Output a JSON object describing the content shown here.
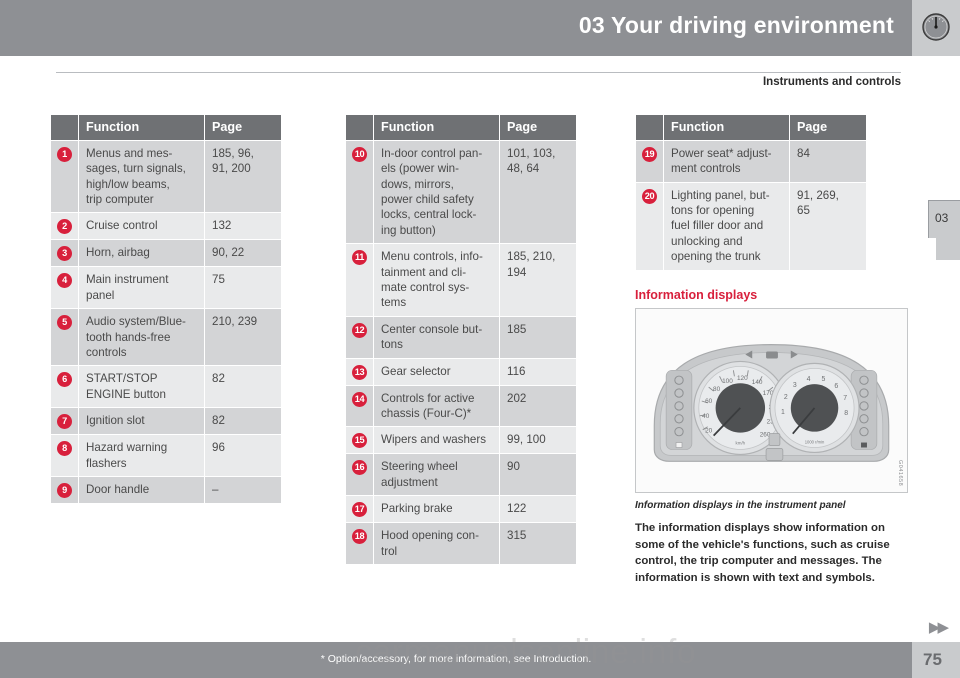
{
  "header": {
    "title": "03 Your driving environment",
    "gauge_icon": "gauge-icon",
    "subtitle": "Instruments and controls"
  },
  "chapter_tab": {
    "label": "03"
  },
  "tables": [
    {
      "id": "table-1",
      "headers": {
        "number": "",
        "function": "Function",
        "page": "Page"
      },
      "rows": [
        {
          "number": "1",
          "function": "Menus and mes-\nsages, turn signals,\nhigh/low beams,\ntrip computer",
          "page": "185, 96,\n91, 200"
        },
        {
          "number": "2",
          "function": "Cruise control",
          "page": "132"
        },
        {
          "number": "3",
          "function": "Horn, airbag",
          "page": "90, 22"
        },
        {
          "number": "4",
          "function": "Main instrument\npanel",
          "page": "75"
        },
        {
          "number": "5",
          "function": "Audio system/Blue-\ntooth hands-free\ncontrols",
          "page": "210, 239"
        },
        {
          "number": "6",
          "function": "START/STOP\nENGINE button",
          "page": "82"
        },
        {
          "number": "7",
          "function": "Ignition slot",
          "page": "82"
        },
        {
          "number": "8",
          "function": "Hazard warning\nflashers",
          "page": "96"
        },
        {
          "number": "9",
          "function": "Door handle",
          "page": "–"
        }
      ]
    },
    {
      "id": "table-2",
      "headers": {
        "number": "",
        "function": "Function",
        "page": "Page"
      },
      "rows": [
        {
          "number": "10",
          "function": "In-door control pan-\nels (power win-\ndows, mirrors,\npower child safety\nlocks, central lock-\ning button)",
          "page": "101, 103,\n48, 64"
        },
        {
          "number": "11",
          "function": "Menu controls, info-\ntainment and cli-\nmate control sys-\ntems",
          "page": "185, 210,\n194"
        },
        {
          "number": "12",
          "function": "Center console but-\ntons",
          "page": "185"
        },
        {
          "number": "13",
          "function": "Gear selector",
          "page": "116"
        },
        {
          "number": "14",
          "function": "Controls for active\nchassis (Four-C)*",
          "page": "202"
        },
        {
          "number": "15",
          "function": "Wipers and washers",
          "page": "99, 100"
        },
        {
          "number": "16",
          "function": "Steering wheel\nadjustment",
          "page": "90"
        },
        {
          "number": "17",
          "function": "Parking brake",
          "page": "122"
        },
        {
          "number": "18",
          "function": "Hood opening con-\ntrol",
          "page": "315"
        }
      ]
    },
    {
      "id": "table-3",
      "headers": {
        "number": "",
        "function": "Function",
        "page": "Page"
      },
      "rows": [
        {
          "number": "19",
          "function": "Power seat* adjust-\nment controls",
          "page": "84"
        },
        {
          "number": "20",
          "function": "Lighting panel, but-\ntons for opening\nfuel filler door and\nunlocking and\nopening the trunk",
          "page": "91, 269,\n65"
        }
      ]
    }
  ],
  "info_section": {
    "heading": "Information displays",
    "figure_code": "G041658",
    "figure_caption": "Information displays in the instrument panel",
    "body": "The information displays show information on some of the vehicle's functions, such as cruise control, the trip computer and messages. The information is shown with text and symbols.",
    "speedometer_ticks": [
      "20",
      "40",
      "60",
      "80",
      "100",
      "120",
      "140",
      "170",
      "200",
      "230",
      "260"
    ],
    "speedometer_unit": "km/h",
    "tachometer_ticks": [
      "1",
      "2",
      "3",
      "4",
      "5",
      "6",
      "7",
      "8"
    ],
    "tachometer_unit": "1000 r/min"
  },
  "footer": {
    "footnote": "* Option/accessory, for more information, see Introduction.",
    "page_number": "75",
    "forward_marker": "▶▶"
  },
  "watermark": "carmanualsonline.info",
  "colors": {
    "accent_red": "#d8203c",
    "header_gray": "#8e9094",
    "table_header_gray": "#6f7174",
    "row_odd": "#d3d4d6",
    "row_even": "#e9eaeb"
  }
}
